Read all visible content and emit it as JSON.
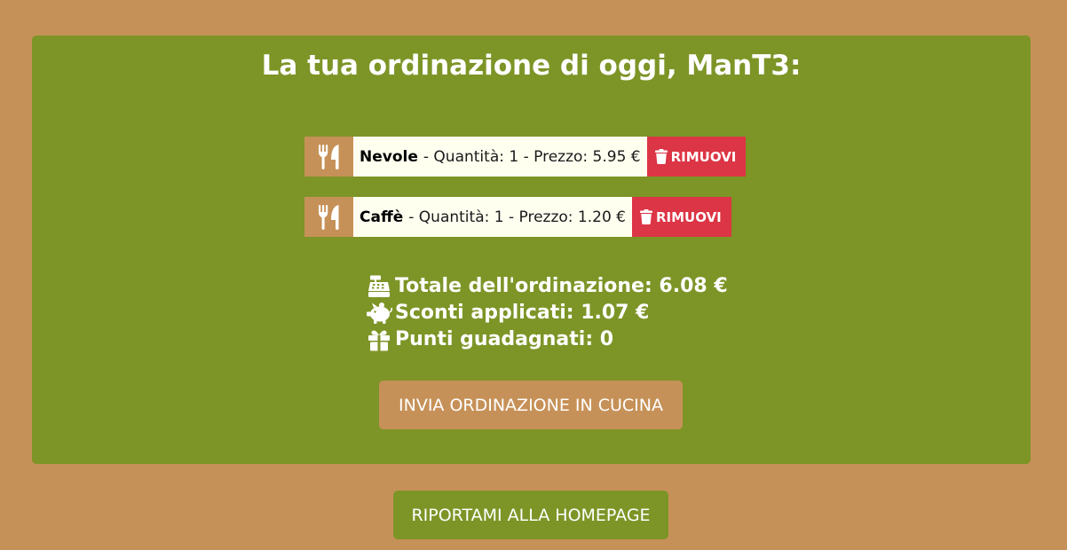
{
  "order": {
    "title": "La tua ordinazione di oggi, ManT3:",
    "items": [
      {
        "name": "Nevole",
        "details": "- Quantità: 1 - Prezzo: 5.95 €",
        "remove_label": "RIMUOVI",
        "icon": "utensils-icon"
      },
      {
        "name": "Caffè",
        "details": "- Quantità: 1 - Prezzo: 1.20 €",
        "remove_label": "RIMUOVI",
        "icon": "utensils-icon"
      }
    ],
    "summary": {
      "total": "Totale dell'ordinazione: 6.08 €",
      "discounts": "Sconti applicati: 1.07 €",
      "points": "Punti guadagnati: 0"
    },
    "send_label": "INVIA ORDINAZIONE IN CUCINA"
  },
  "footer": {
    "home_label": "RIPORTAMI ALLA HOMEPAGE"
  },
  "colors": {
    "page_background": "#c69158",
    "card_background": "#7d9527",
    "remove_button": "#dc3545",
    "item_background": "#fffff0"
  }
}
